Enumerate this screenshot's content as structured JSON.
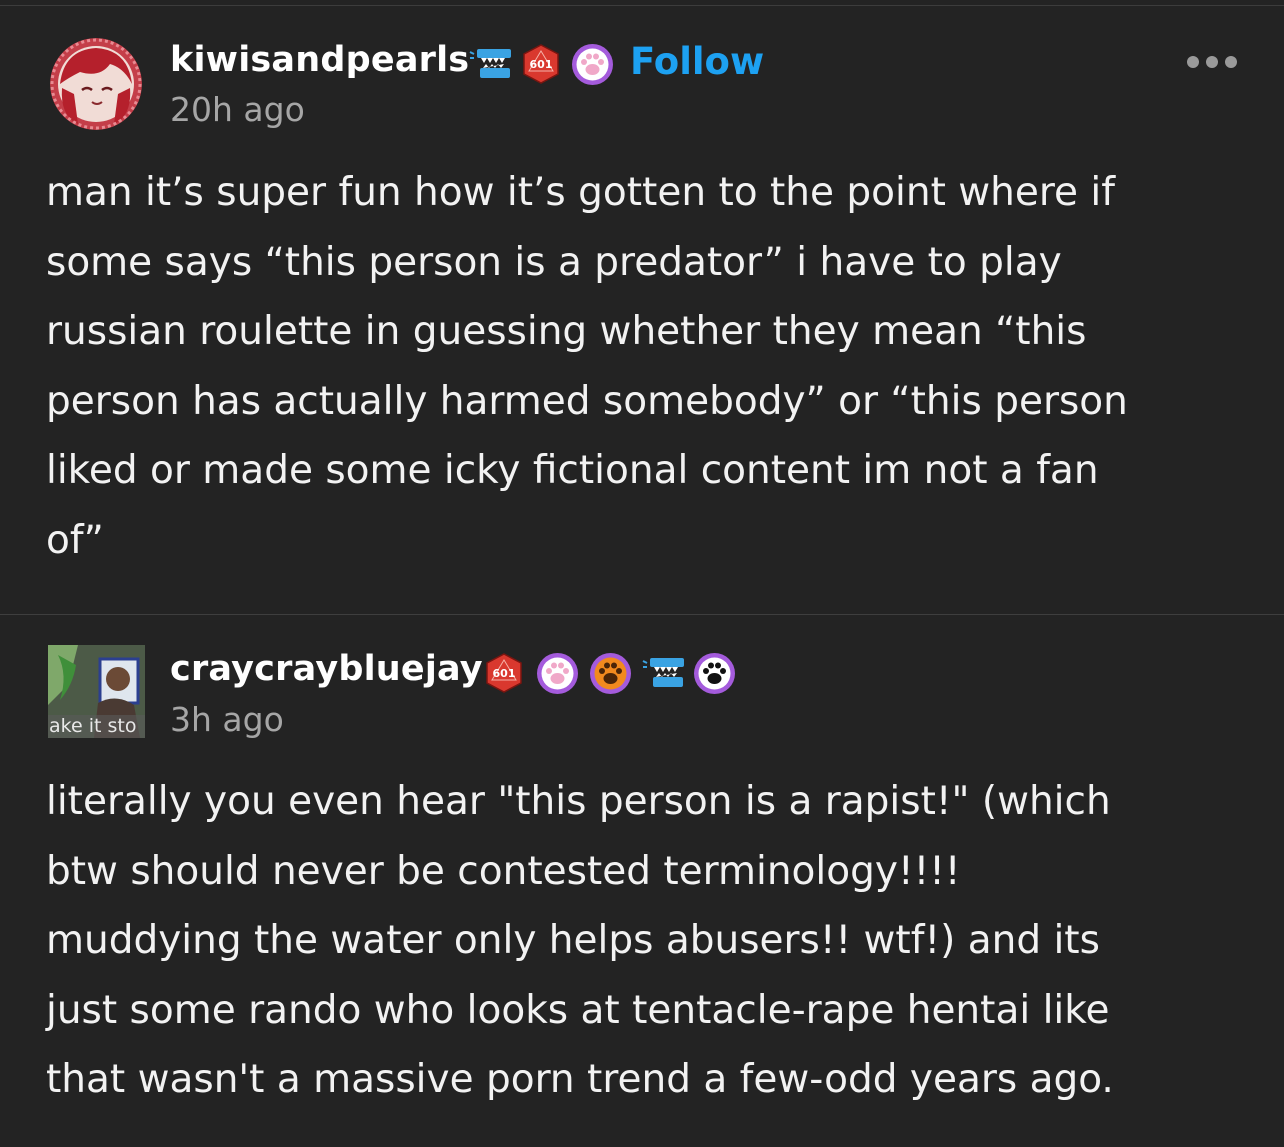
{
  "posts": [
    {
      "username": "kiwisandpearls",
      "timestamp": "20h ago",
      "follow_label": "Follow",
      "badges": [
        "teeth-badge-icon",
        "d20-601-badge-icon",
        "paw-badge-icon"
      ],
      "badge_text": "601",
      "body": "man it’s super fun how it’s gotten to the point where if\nsome says “this person is a predator” i have to play\nrussian roulette in guessing whether they mean “this\nperson has actually harmed somebody” or “this person\nliked or made some icky fictional content im not a fan\nof”"
    },
    {
      "username": "craycraybluejay",
      "timestamp": "3h ago",
      "avatar_caption": "ake it sto",
      "badges": [
        "d20-601-badge-icon",
        "paw-badge-icon",
        "paw-orange-badge-icon",
        "teeth-badge-icon",
        "paw-black-badge-icon"
      ],
      "badge_text": "601",
      "body": "literally you even hear \"this person is a rapist!\" (which\nbtw should never be contested terminology!!!!\nmuddying the water only helps abusers!! wtf!) and its\njust some rando who looks at tentacle-rape hentai like\nthat wasn't a massive porn trend a few-odd years ago."
    }
  ],
  "colors": {
    "background": "#232323",
    "follow": "#1da1f2",
    "timestamp": "#a6a6a6",
    "d20_badge": "#d9382e",
    "paw_badge": "#a45bdc",
    "teeth_badge": "#3aa3e3"
  }
}
